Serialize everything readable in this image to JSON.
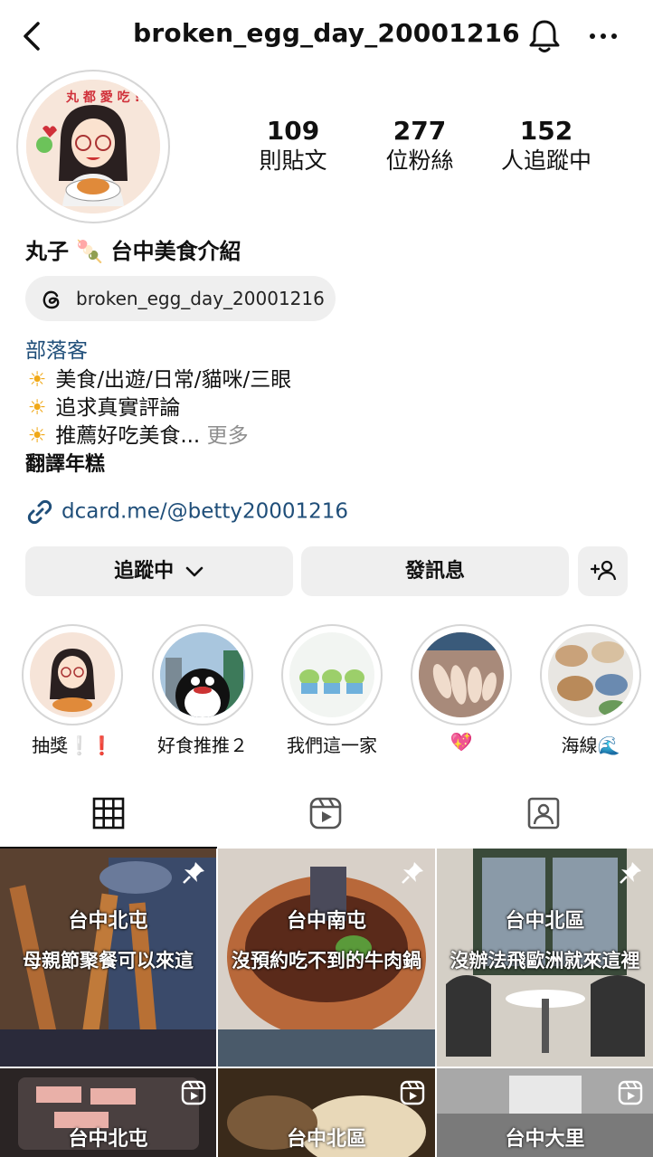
{
  "header": {
    "username": "broken_egg_day_20001216"
  },
  "stats": [
    {
      "value": "109",
      "label": "則貼文"
    },
    {
      "value": "277",
      "label": "位粉絲"
    },
    {
      "value": "152",
      "label": "人追蹤中"
    }
  ],
  "profile": {
    "display_name": "丸子 🍡   台中美食介紹",
    "threads_handle": "broken_egg_day_20001216",
    "category": "部落客",
    "bio_lines": [
      "美食/出遊/日常/貓咪/三眼",
      "追求真實評論",
      "推薦好吃美食..."
    ],
    "bio_more": "更多",
    "translate": "翻譯年糕",
    "link": "dcard.me/@betty20001216",
    "avatar_text": "丸 都 愛 吃 !!"
  },
  "actions": {
    "following": "追蹤中",
    "message": "發訊息"
  },
  "highlights": [
    {
      "label": "抽獎❕❗"
    },
    {
      "label": "好食推推２"
    },
    {
      "label": "我們這一家"
    },
    {
      "label": "💖"
    },
    {
      "label": "海線🌊"
    }
  ],
  "posts": [
    {
      "location": "台中北屯",
      "caption": "母親節聚餐可以來這",
      "pinned": true
    },
    {
      "location": "台中南屯",
      "caption": "沒預約吃不到的牛肉鍋",
      "pinned": true
    },
    {
      "location": "台中北區",
      "caption": "沒辦法飛歐洲就來這裡",
      "pinned": true
    },
    {
      "location": "台中北屯",
      "reel": true
    },
    {
      "location": "台中北區",
      "reel": true
    },
    {
      "location": "台中大里",
      "reel": true
    }
  ],
  "colors": {
    "link_blue": "#1f4e79",
    "button_gray": "#efefef",
    "ring_gray": "#d6d6d6"
  }
}
